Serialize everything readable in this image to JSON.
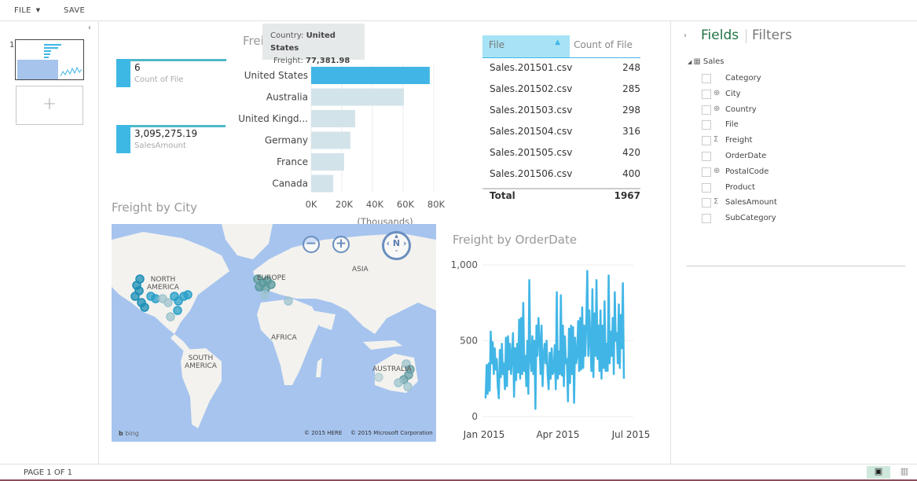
{
  "topbar": {
    "file_label": "FILE",
    "save_label": "SAVE"
  },
  "left_pane": {
    "page_number": "1",
    "add_page_icon": "+"
  },
  "cards": [
    {
      "value": "6",
      "label": "Count of File"
    },
    {
      "value": "3,095,275.19",
      "label": "SalesAmount"
    }
  ],
  "freight_by_country": {
    "title_visible": "Frei",
    "tooltip": {
      "country_label": "Country:",
      "country_value": "United States",
      "freight_label": "Freight:",
      "freight_value": "77,381.98"
    },
    "highlight_color": "#41b6e6",
    "dim_color": "#d3e3ea"
  },
  "table": {
    "headers": [
      "File",
      "Count of File"
    ],
    "rows": [
      [
        "Sales.201501.csv",
        "248"
      ],
      [
        "Sales.201502.csv",
        "285"
      ],
      [
        "Sales.201503.csv",
        "298"
      ],
      [
        "Sales.201504.csv",
        "316"
      ],
      [
        "Sales.201505.csv",
        "420"
      ],
      [
        "Sales.201506.csv",
        "400"
      ]
    ],
    "total_label": "Total",
    "total_value": "1967"
  },
  "map": {
    "title": "Freight by City",
    "labels": [
      "NORTH AMERICA",
      "EUROPE",
      "ASIA",
      "AFRICA",
      "SOUTH AMERICA",
      "AUSTRALIA"
    ],
    "zoom_out": "−",
    "zoom_in": "+",
    "compass": "N",
    "bing": "bing",
    "copyright_here": "© 2015 HERE",
    "copyright_ms": "© 2015 Microsoft Corporation"
  },
  "right_pane": {
    "tab_fields": "Fields",
    "tab_filters": "Filters",
    "table_name": "Sales",
    "fields": [
      {
        "name": "Category",
        "icon": ""
      },
      {
        "name": "City",
        "icon": "globe"
      },
      {
        "name": "Country",
        "icon": "globe"
      },
      {
        "name": "File",
        "icon": ""
      },
      {
        "name": "Freight",
        "icon": "sigma"
      },
      {
        "name": "OrderDate",
        "icon": ""
      },
      {
        "name": "PostalCode",
        "icon": "globe"
      },
      {
        "name": "Product",
        "icon": ""
      },
      {
        "name": "SalesAmount",
        "icon": "sigma"
      },
      {
        "name": "SubCategory",
        "icon": ""
      }
    ]
  },
  "status": {
    "page_label": "PAGE 1 OF 1"
  },
  "colors": {
    "accent": "#41b6e6",
    "fields_green": "#217346",
    "card_border": "#4fb8c9"
  },
  "chart_data": [
    {
      "type": "bar",
      "orientation": "horizontal",
      "title": "Freight by Country",
      "categories": [
        "United States",
        "Australia",
        "United Kingd...",
        "Germany",
        "France",
        "Canada"
      ],
      "values": [
        77381.98,
        60500,
        28700,
        25600,
        21500,
        14400
      ],
      "highlighted": "United States",
      "xlabel": "(Thousands)",
      "xticks": [
        "0K",
        "20K",
        "40K",
        "60K",
        "80K"
      ],
      "xlim": [
        0,
        80000
      ],
      "grid": true
    },
    {
      "type": "line",
      "title": "Freight by OrderDate",
      "xticks": [
        "Jan 2015",
        "Apr 2015",
        "Jul 2015"
      ],
      "yticks": [
        "0",
        "500",
        "1,000"
      ],
      "ylim": [
        0,
        1000
      ],
      "x_range": [
        "2015-01-01",
        "2015-06-30"
      ],
      "grid": true,
      "color": "#41b6e6",
      "values": [
        120,
        340,
        150,
        350,
        170,
        560,
        350,
        490,
        280,
        450,
        310,
        380,
        200,
        120,
        440,
        260,
        480,
        280,
        350,
        180,
        520,
        200,
        530,
        310,
        480,
        280,
        400,
        550,
        130,
        450,
        240,
        480,
        290,
        640,
        250,
        650,
        280,
        750,
        300,
        400,
        200,
        500,
        150,
        900,
        380,
        300,
        530,
        280,
        500,
        50,
        600,
        400,
        650,
        500,
        280,
        600,
        200,
        400,
        480,
        350,
        500,
        280,
        180,
        420,
        250,
        450,
        280,
        300,
        470,
        180,
        820,
        250,
        430,
        280,
        800,
        270,
        600,
        200,
        530,
        350,
        380,
        100,
        580,
        220,
        600,
        280,
        590,
        90,
        520,
        350,
        400,
        630,
        300,
        650,
        310,
        720,
        320,
        600,
        400,
        610,
        960,
        400,
        700,
        500,
        300,
        840,
        260,
        680,
        400,
        900,
        380,
        600,
        300,
        700,
        250,
        600,
        320,
        760,
        300,
        480,
        300,
        930,
        350,
        560,
        400,
        650,
        280,
        820,
        500,
        550,
        350,
        740,
        320,
        670,
        450,
        880,
        250
      ],
      "note": "approximate daily series read from plot"
    }
  ]
}
